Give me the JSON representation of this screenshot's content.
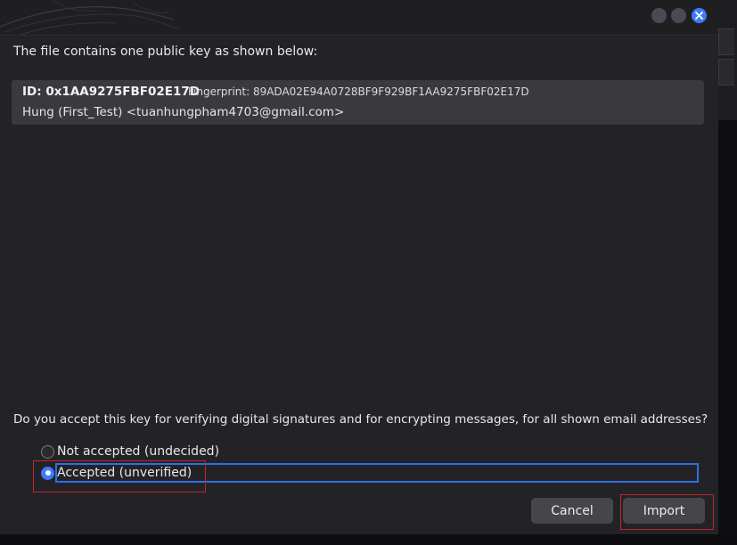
{
  "dialog": {
    "intro_text": "The file contains one public key as shown below:",
    "key": {
      "id": "ID: 0x1AA9275FBF02E17D",
      "fingerprint": "Fingerprint: 89ADA02E94A0728BF9F929BF1AA9275FBF02E17D",
      "user": "Hung (First_Test) <tuanhungpham4703@gmail.com>"
    },
    "question": "Do you accept this key for verifying digital signatures and for encrypting messages, for all shown email addresses?",
    "options": [
      {
        "label": "Not accepted (undecided)",
        "selected": false
      },
      {
        "label": "Accepted (unverified)",
        "selected": true
      }
    ],
    "buttons": {
      "cancel": "Cancel",
      "import": "Import"
    }
  },
  "colors": {
    "accent": "#3d7bf7",
    "annotation": "#c0262c",
    "dialog_bg": "#232327",
    "key_box_bg": "#3a3a3e"
  },
  "icons": [
    "minimize-icon",
    "maximize-icon",
    "close-icon"
  ]
}
